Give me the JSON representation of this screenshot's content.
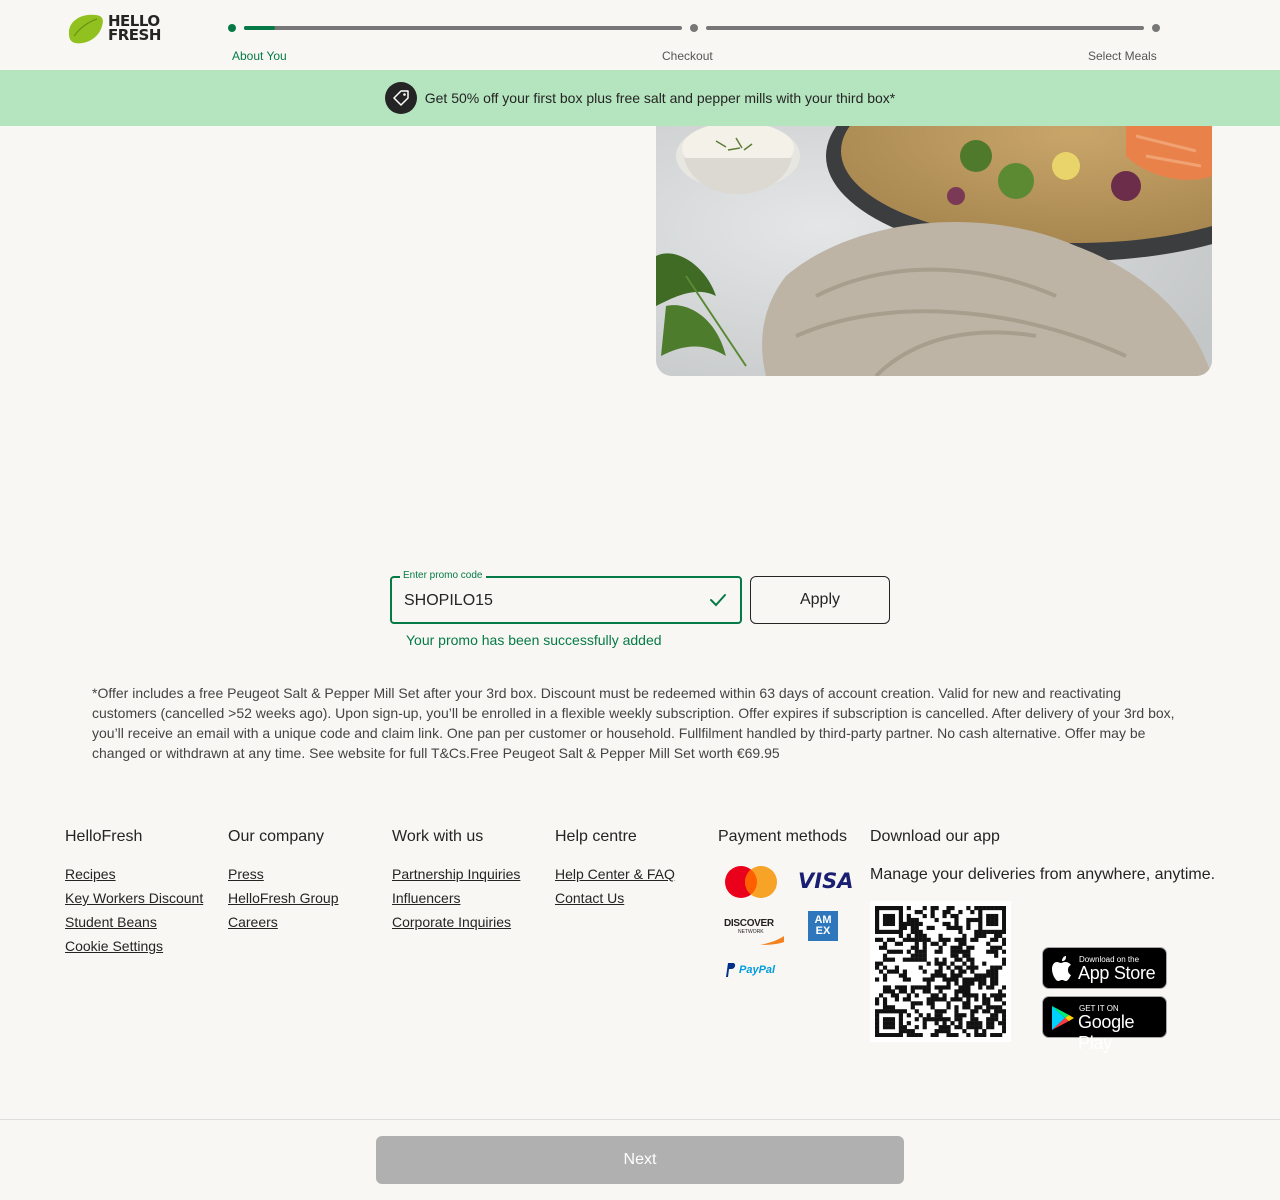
{
  "header": {
    "logo_line1": "HELLO",
    "logo_line2": "FRESH",
    "steps": [
      {
        "label": "About You",
        "active": true
      },
      {
        "label": "Checkout",
        "active": false
      },
      {
        "label": "Select Meals",
        "active": false
      }
    ],
    "progress_fraction_step1": 0.07
  },
  "banner": {
    "text": "Get 50% off your first box plus free salt and pepper mills with your third box*"
  },
  "promo": {
    "legend": "Enter promo code",
    "value": "SHOPILO15",
    "apply_label": "Apply",
    "success_message": "Your promo has been successfully added"
  },
  "terms": "*Offer includes a free Peugeot Salt & Pepper Mill Set after your 3rd box. Discount must be redeemed within 63 days of account creation. Valid for new and reactivating customers (cancelled >52 weeks ago). Upon sign-up, you’ll be enrolled in a flexible weekly subscription. Offer expires if subscription is cancelled. After delivery of your 3rd box, you’ll receive an email with a unique code and claim link. One pan per customer or household. Fullfilment handled by third-party partner. No cash alternative. Offer may be changed or withdrawn at any time. See website for full T&Cs.Free Peugeot Salt & Pepper Mill Set worth €69.95",
  "footer": {
    "columns": [
      {
        "title": "HelloFresh",
        "links": [
          "Recipes",
          "Key Workers Discount",
          "Student Beans",
          "Cookie Settings"
        ]
      },
      {
        "title": "Our company",
        "links": [
          "Press",
          "HelloFresh Group",
          "Careers"
        ]
      },
      {
        "title": "Work with us",
        "links": [
          "Partnership Inquiries",
          "Influencers",
          "Corporate Inquiries"
        ]
      },
      {
        "title": "Help centre",
        "links": [
          "Help Center & FAQ",
          "Contact Us"
        ]
      }
    ],
    "payment_title": "Payment methods",
    "payment": {
      "visa": "VISA",
      "discover": "DISCOVER",
      "discover_sub": "NETWORK",
      "amex": "AM EX",
      "paypal": "PayPal"
    },
    "app_title": "Download our app",
    "app_text": "Manage your deliveries from anywhere, anytime.",
    "app_store_small": "Download on the",
    "app_store_big": "App Store",
    "google_small": "GET IT ON",
    "google_big": "Google Play"
  },
  "next_label": "Next",
  "colors": {
    "brand_green": "#067a46",
    "banner_bg": "#b5e5bf",
    "logo_lime": "#91c11e",
    "disabled_button": "#b0b0b0"
  }
}
